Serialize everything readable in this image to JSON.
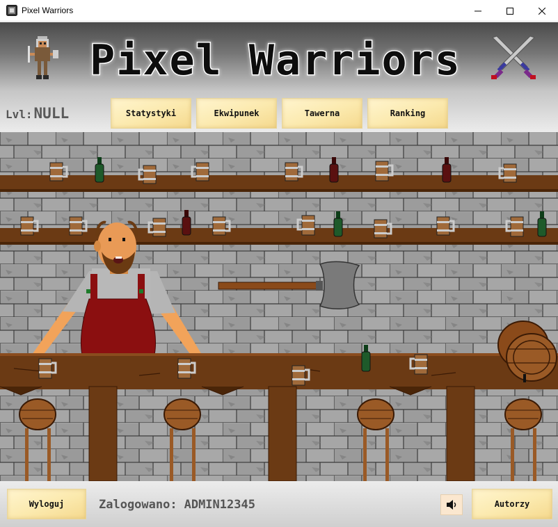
{
  "window": {
    "title": "Pixel Warriors",
    "icon": "pw-app-icon",
    "controls": [
      "minimize-icon",
      "maximize-icon",
      "close-icon"
    ]
  },
  "header": {
    "title": "Pixel Warriors"
  },
  "menu": {
    "level_label": "Lvl:",
    "level_value": "NULL",
    "items": [
      "Statystyki",
      "Ekwipunek",
      "Tawerna",
      "Ranking"
    ]
  },
  "scene": {
    "name": "tavern",
    "objects": [
      "barkeeper",
      "axe",
      "barrel",
      "mugs",
      "bottles",
      "stools",
      "shelves",
      "counter"
    ]
  },
  "footer": {
    "logout_label": "Wyloguj",
    "logged_label": "Zalogowano:",
    "username": "ADMIN12345",
    "sound_icon": "speaker-icon",
    "authors_label": "Autorzy"
  },
  "colors": {
    "parchment": "#fbe9ad",
    "stone": "#9c9c9c",
    "wood": "#6b3a14",
    "apron": "#8b0f10"
  }
}
